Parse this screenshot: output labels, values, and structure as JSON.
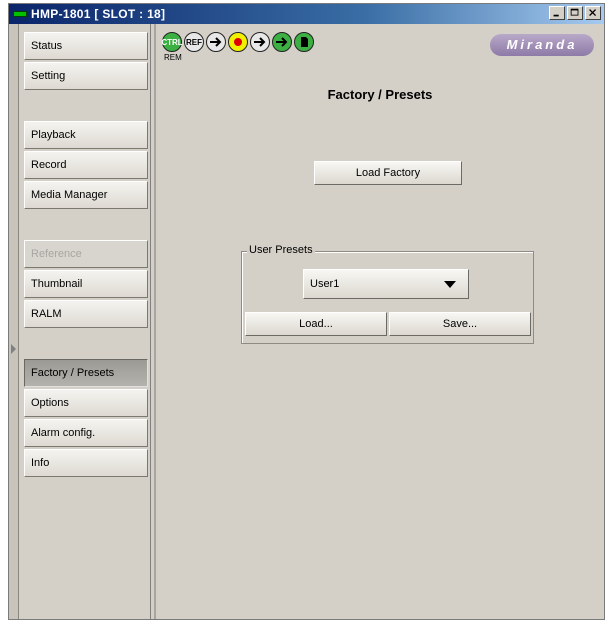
{
  "window": {
    "title": "HMP-1801 [ SLOT : 18]",
    "buttons": [
      "minimize-icon",
      "maximize-icon",
      "close-icon"
    ]
  },
  "sidebar": {
    "items": [
      {
        "label": "Status",
        "state": "normal"
      },
      {
        "label": "Setting",
        "state": "normal"
      },
      {
        "label": "Playback",
        "state": "normal"
      },
      {
        "label": "Record",
        "state": "normal"
      },
      {
        "label": "Media Manager",
        "state": "normal"
      },
      {
        "label": "Reference",
        "state": "disabled"
      },
      {
        "label": "Thumbnail",
        "state": "normal"
      },
      {
        "label": "RALM",
        "state": "normal"
      },
      {
        "label": "Factory / Presets",
        "state": "active"
      },
      {
        "label": "Options",
        "state": "normal"
      },
      {
        "label": "Alarm config.",
        "state": "normal"
      },
      {
        "label": "Info",
        "state": "normal"
      }
    ]
  },
  "toolbar": {
    "icons": [
      {
        "name": "ctrl-icon",
        "label": "CTRL",
        "color": "#3cb043"
      },
      {
        "name": "ref-icon",
        "label": "REF",
        "color": "#e8e8e8"
      },
      {
        "name": "input-arrow-icon",
        "label": "",
        "color": "#e8e8e8"
      },
      {
        "name": "record-icon",
        "label": "",
        "color": "#f0f000"
      },
      {
        "name": "output-arrow-icon",
        "label": "",
        "color": "#e8e8e8"
      },
      {
        "name": "playback-arrow-icon",
        "label": "",
        "color": "#3cb043"
      },
      {
        "name": "storage-icon",
        "label": "",
        "color": "#3cb043"
      }
    ],
    "rem_label": "REM",
    "logo_text": "Miranda"
  },
  "main": {
    "title": "Factory / Presets",
    "load_factory_label": "Load Factory",
    "user_presets": {
      "group_label": "User Presets",
      "selected": "User1",
      "load_label": "Load...",
      "save_label": "Save..."
    }
  }
}
